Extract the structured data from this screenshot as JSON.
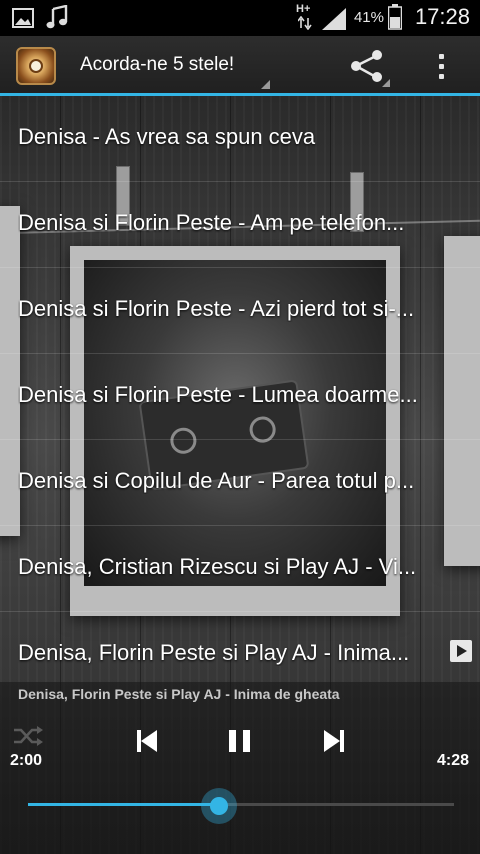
{
  "status_bar": {
    "icons": [
      "gallery-icon",
      "music-note-icon",
      "hplus-data-icon",
      "signal-icon",
      "battery-icon"
    ],
    "network_label": "H+",
    "battery": "41%",
    "time": "17:28"
  },
  "action_bar": {
    "title": "Acorda-ne 5 stele!",
    "accent_color": "#33b5e5",
    "icons": [
      "app-logo",
      "share-icon",
      "overflow-menu-icon"
    ]
  },
  "songs": [
    {
      "title": "Denisa - As vrea sa spun ceva"
    },
    {
      "title": "Denisa si Florin Peste - Am pe telefon..."
    },
    {
      "title": "Denisa si Florin Peste - Azi pierd tot si-..."
    },
    {
      "title": "Denisa si Florin Peste - Lumea doarme..."
    },
    {
      "title": "Denisa si Copilul de Aur - Parea totul p..."
    },
    {
      "title": "Denisa, Cristian Rizescu si Play AJ - Vi..."
    },
    {
      "title": "Denisa, Florin Peste si Play AJ - Inima..."
    }
  ],
  "player": {
    "now_playing": "Denisa, Florin Peste si Play AJ - Inima de gheata",
    "elapsed": "2:00",
    "total": "4:28",
    "progress": 0.448,
    "controls": [
      "shuffle-icon",
      "previous-icon",
      "pause-icon",
      "next-icon"
    ]
  }
}
